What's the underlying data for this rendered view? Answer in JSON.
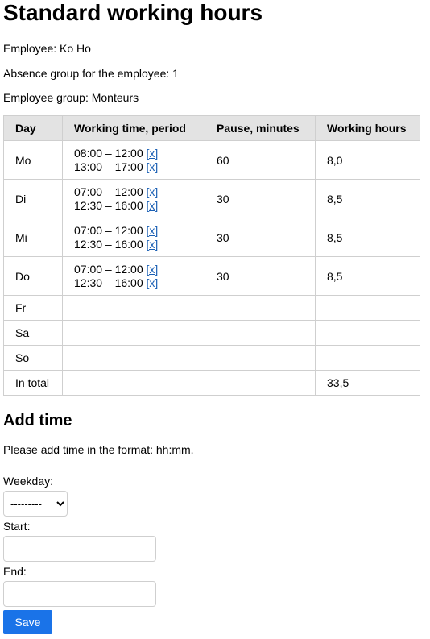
{
  "page": {
    "title": "Standard working hours",
    "employee": "Employee: Ko Ho",
    "absence_group": "Absence group for the employee: 1",
    "employee_group": "Employee group: Monteurs"
  },
  "table": {
    "headers": [
      "Day",
      "Working time, period",
      "Pause, minutes",
      "Working hours"
    ],
    "rows": [
      {
        "day": "Mo",
        "periods": [
          "08:00 – 12:00",
          "13:00 – 17:00"
        ],
        "pause": "60",
        "hours": "8,0"
      },
      {
        "day": "Di",
        "periods": [
          "07:00 – 12:00",
          "12:30 – 16:00"
        ],
        "pause": "30",
        "hours": "8,5"
      },
      {
        "day": "Mi",
        "periods": [
          "07:00 – 12:00",
          "12:30 – 16:00"
        ],
        "pause": "30",
        "hours": "8,5"
      },
      {
        "day": "Do",
        "periods": [
          "07:00 – 12:00",
          "12:30 – 16:00"
        ],
        "pause": "30",
        "hours": "8,5"
      },
      {
        "day": "Fr",
        "periods": [],
        "pause": "",
        "hours": ""
      },
      {
        "day": "Sa",
        "periods": [],
        "pause": "",
        "hours": ""
      },
      {
        "day": "So",
        "periods": [],
        "pause": "",
        "hours": ""
      }
    ],
    "remove_link": "[x]",
    "total_label": "In total",
    "total_hours": "33,5"
  },
  "form": {
    "heading": "Add time",
    "hint": "Please add time in the format: hh:mm.",
    "weekday_label": "Weekday:",
    "weekday_selected": "---------",
    "start_label": "Start:",
    "start_value": "",
    "end_label": "End:",
    "end_value": "",
    "save_label": "Save"
  },
  "colors": {
    "link": "#1a5fb4",
    "header_bg": "#e3e3e3",
    "button_bg": "#1a73e8"
  }
}
